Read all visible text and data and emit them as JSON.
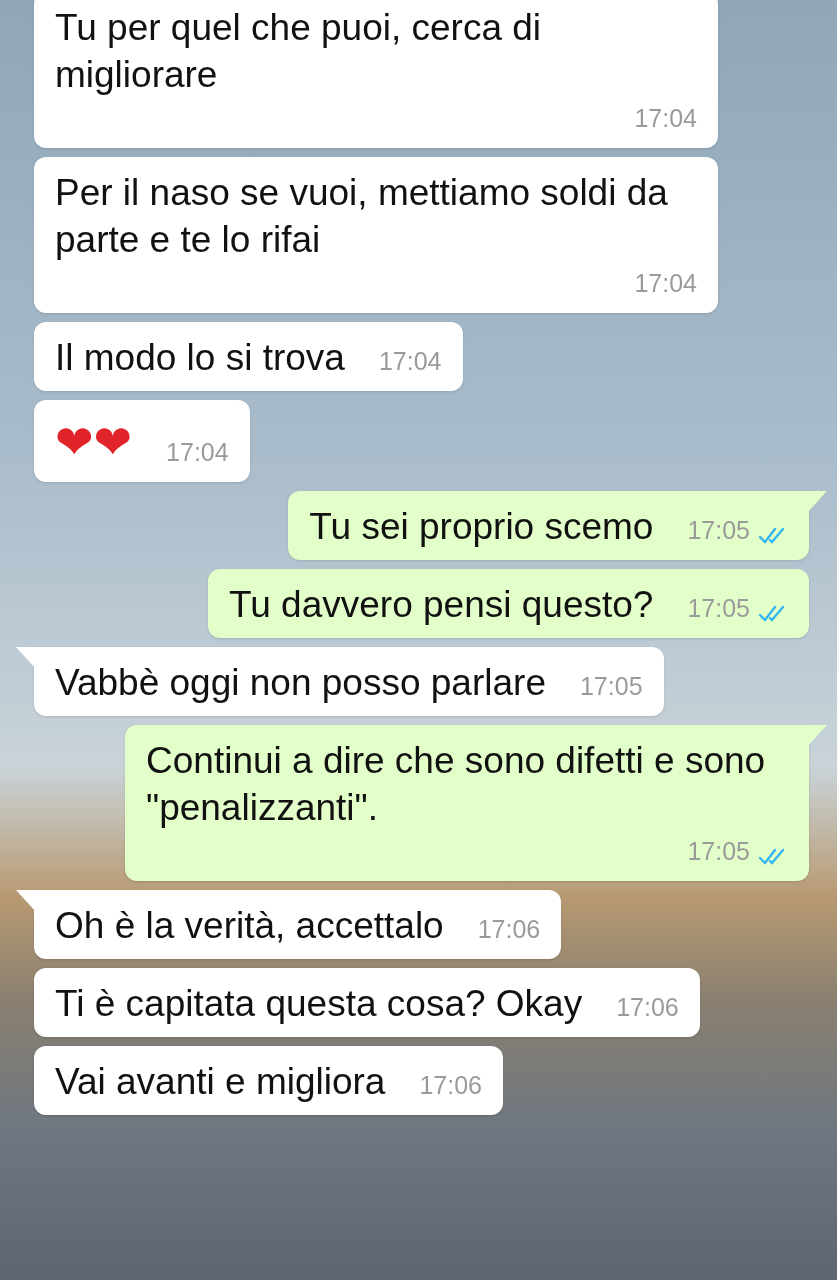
{
  "messages": [
    {
      "kind": "received",
      "text": "Tu per quel che puoi, cerca di migliorare",
      "time": "17:04",
      "tail": false
    },
    {
      "kind": "received",
      "text": "Per il naso se vuoi, mettiamo soldi da parte e te lo rifai",
      "time": "17:04",
      "tail": false
    },
    {
      "kind": "received",
      "text": "Il modo lo si trova",
      "time": "17:04",
      "tail": false
    },
    {
      "kind": "emoji",
      "text": "❤❤",
      "time": "17:04",
      "tail": false
    },
    {
      "kind": "sent",
      "text": "Tu sei proprio scemo",
      "time": "17:05",
      "tail": true,
      "read": true
    },
    {
      "kind": "sent",
      "text": "Tu davvero pensi questo?",
      "time": "17:05",
      "tail": false,
      "read": true
    },
    {
      "kind": "received",
      "text": "Vabbè oggi non posso parlare",
      "time": "17:05",
      "tail": true
    },
    {
      "kind": "sent",
      "text": "Continui a dire che sono difetti e sono \"penalizzanti\".",
      "time": "17:05",
      "tail": true,
      "read": true
    },
    {
      "kind": "received",
      "text": "Oh è la verità, accettalo",
      "time": "17:06",
      "tail": true
    },
    {
      "kind": "received",
      "text": "Ti è capitata questa cosa? Okay",
      "time": "17:06",
      "tail": false
    },
    {
      "kind": "received",
      "text": "Vai avanti e migliora",
      "time": "17:06",
      "tail": false
    }
  ]
}
